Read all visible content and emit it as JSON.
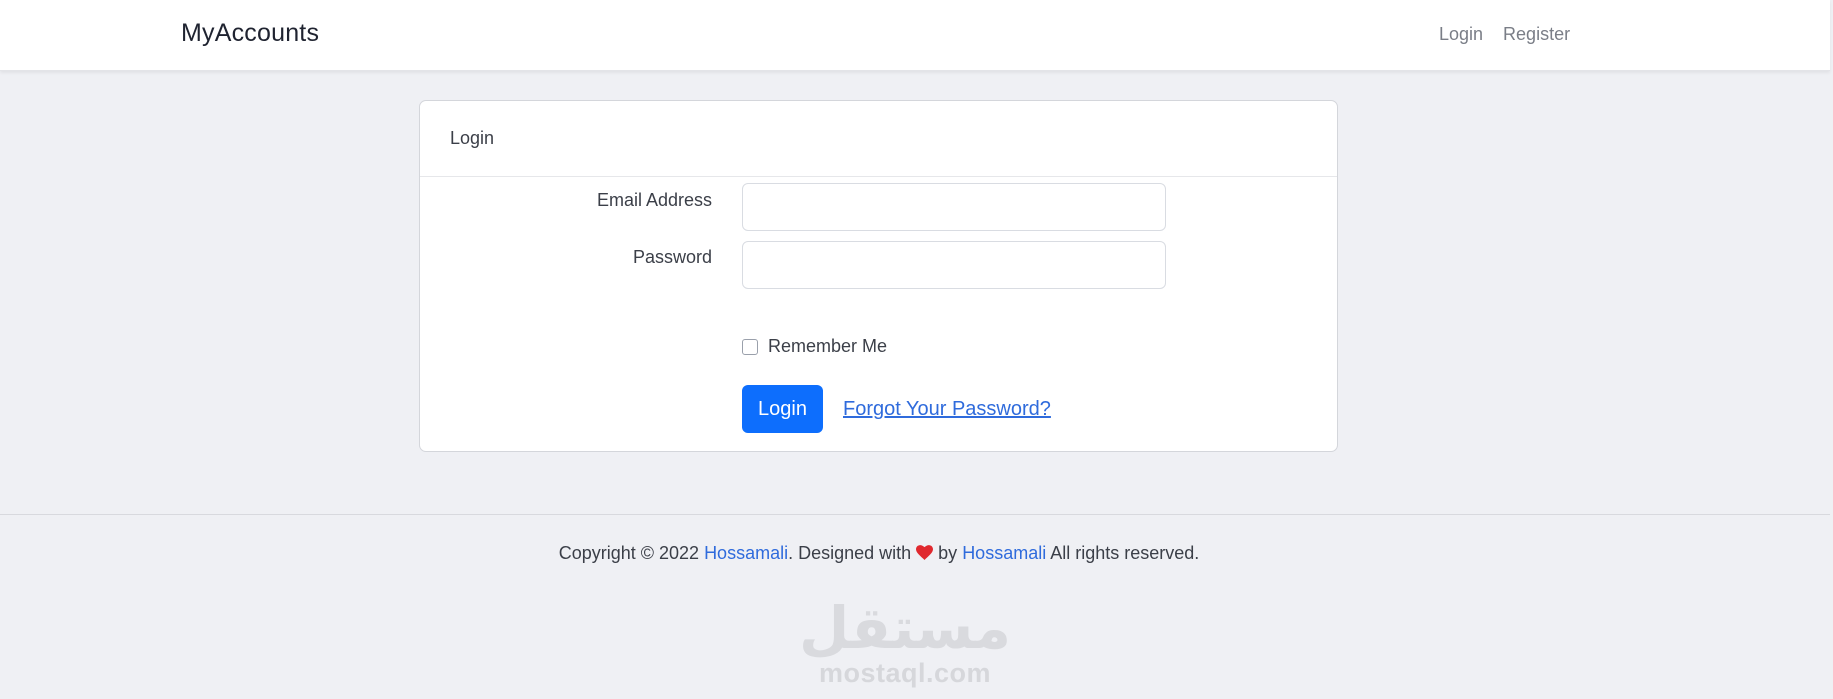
{
  "navbar": {
    "brand": "MyAccounts",
    "links": [
      {
        "label": "Login"
      },
      {
        "label": "Register"
      }
    ]
  },
  "card": {
    "title": "Login",
    "fields": {
      "email": {
        "label": "Email Address",
        "value": "",
        "placeholder": ""
      },
      "password": {
        "label": "Password",
        "value": "",
        "placeholder": ""
      }
    },
    "remember": {
      "label": "Remember Me",
      "checked": false
    },
    "submit_label": "Login",
    "forgot_label": "Forgot Your Password?"
  },
  "footer": {
    "prefix": "Copyright © 2022 ",
    "author_1": "Hossamali",
    "middle_1": ". Designed with ",
    "middle_2": " by ",
    "author_2": "Hossamali",
    "suffix": " All rights reserved.",
    "heart_icon": "heart-icon",
    "heart_color": "#e0282e"
  },
  "watermark": {
    "arabic": "مستقل",
    "latin": "mostaql.com"
  },
  "colors": {
    "accent": "#0d6efd",
    "link": "#2f6bdc",
    "background": "#eff0f4"
  }
}
